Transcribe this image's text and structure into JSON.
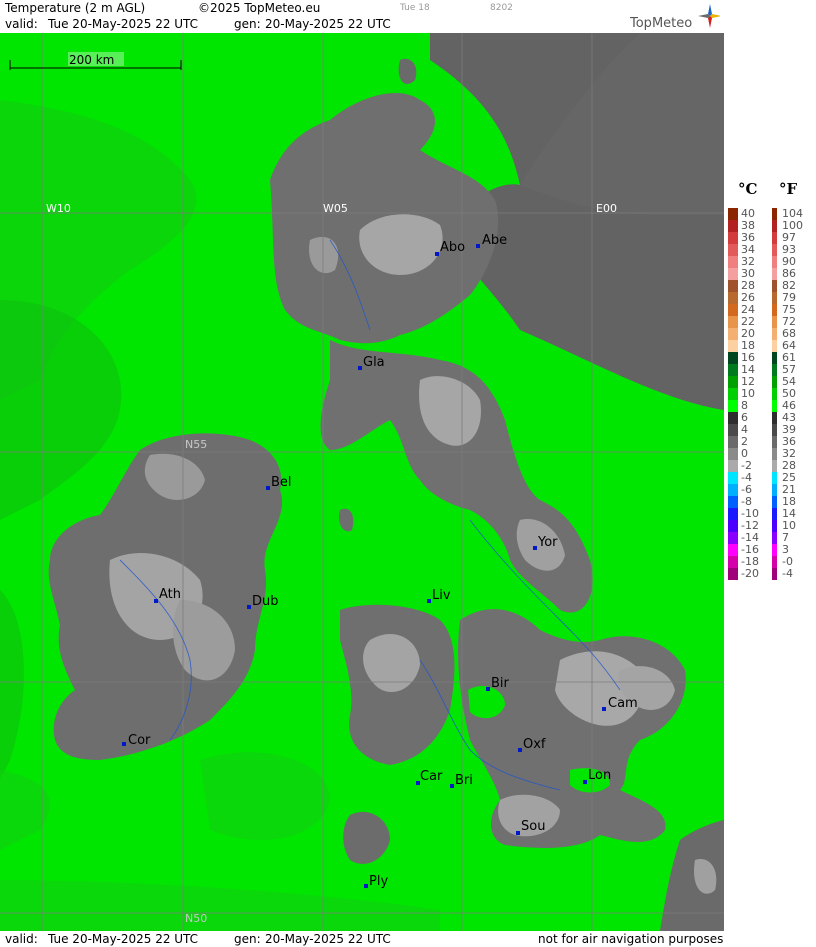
{
  "header": {
    "product": "Temperature (2 m AGL)",
    "copyright": "©2025 TopMeteo.eu",
    "step": "Tue 18",
    "code": "8202",
    "valid_label": "valid:",
    "valid_value": "Tue  20-May-2025  22 UTC",
    "gen_label": "gen:",
    "gen_value": "20-May-2025 22 UTC"
  },
  "logo": {
    "text": "TopMeteo"
  },
  "scale_bar": {
    "label": "200 km"
  },
  "grid_labels": {
    "lon": [
      "W10",
      "W05",
      "E00"
    ],
    "lat": [
      "N55",
      "N50"
    ]
  },
  "cities": [
    {
      "name": "Abo"
    },
    {
      "name": "Abe"
    },
    {
      "name": "Gla"
    },
    {
      "name": "Bel"
    },
    {
      "name": "Yor"
    },
    {
      "name": "Ath"
    },
    {
      "name": "Dub"
    },
    {
      "name": "Liv"
    },
    {
      "name": "Bir"
    },
    {
      "name": "Cam"
    },
    {
      "name": "Cor"
    },
    {
      "name": "Oxf"
    },
    {
      "name": "Car"
    },
    {
      "name": "Bri"
    },
    {
      "name": "Lon"
    },
    {
      "name": "Sou"
    },
    {
      "name": "Ply"
    }
  ],
  "legend": {
    "unit_c": "°C",
    "unit_f": "°F",
    "celsius": [
      "40",
      "38",
      "36",
      "34",
      "32",
      "30",
      "28",
      "26",
      "24",
      "22",
      "20",
      "18",
      "16",
      "14",
      "12",
      "10",
      "8",
      "6",
      "4",
      "2",
      "0",
      "-2",
      "-4",
      "-6",
      "-8",
      "-10",
      "-12",
      "-14",
      "-16",
      "-18",
      "-20"
    ],
    "fahrenheit": [
      "104",
      "100",
      "97",
      "93",
      "90",
      "86",
      "82",
      "79",
      "75",
      "72",
      "68",
      "64",
      "61",
      "57",
      "54",
      "50",
      "46",
      "43",
      "39",
      "36",
      "32",
      "28",
      "25",
      "21",
      "18",
      "14",
      "10",
      "7",
      "3",
      "-0",
      "-4"
    ],
    "colors": [
      "#8b2500",
      "#b22222",
      "#d23c3c",
      "#e25a5a",
      "#f08080",
      "#f4a0a0",
      "#a0522d",
      "#b86a2e",
      "#d2691e",
      "#e8944a",
      "#f4b070",
      "#fcd0a0",
      "#00461e",
      "#007a1e",
      "#00a000",
      "#00d000",
      "#00ff00",
      "#2e2e2e",
      "#4a4a4a",
      "#6a6a6a",
      "#8a8a8a",
      "#aaaaaa",
      "#00e5ff",
      "#00b0ff",
      "#0060ff",
      "#1a1aff",
      "#4b00ff",
      "#8a00ff",
      "#ff00ff",
      "#d400aa",
      "#a0007a"
    ]
  },
  "footer": {
    "valid_label": "valid:",
    "valid_value": "Tue  20-May-2025  22 UTC",
    "gen_label": "gen:",
    "gen_value": "20-May-2025 22 UTC",
    "note": "not for air navigation purposes"
  }
}
